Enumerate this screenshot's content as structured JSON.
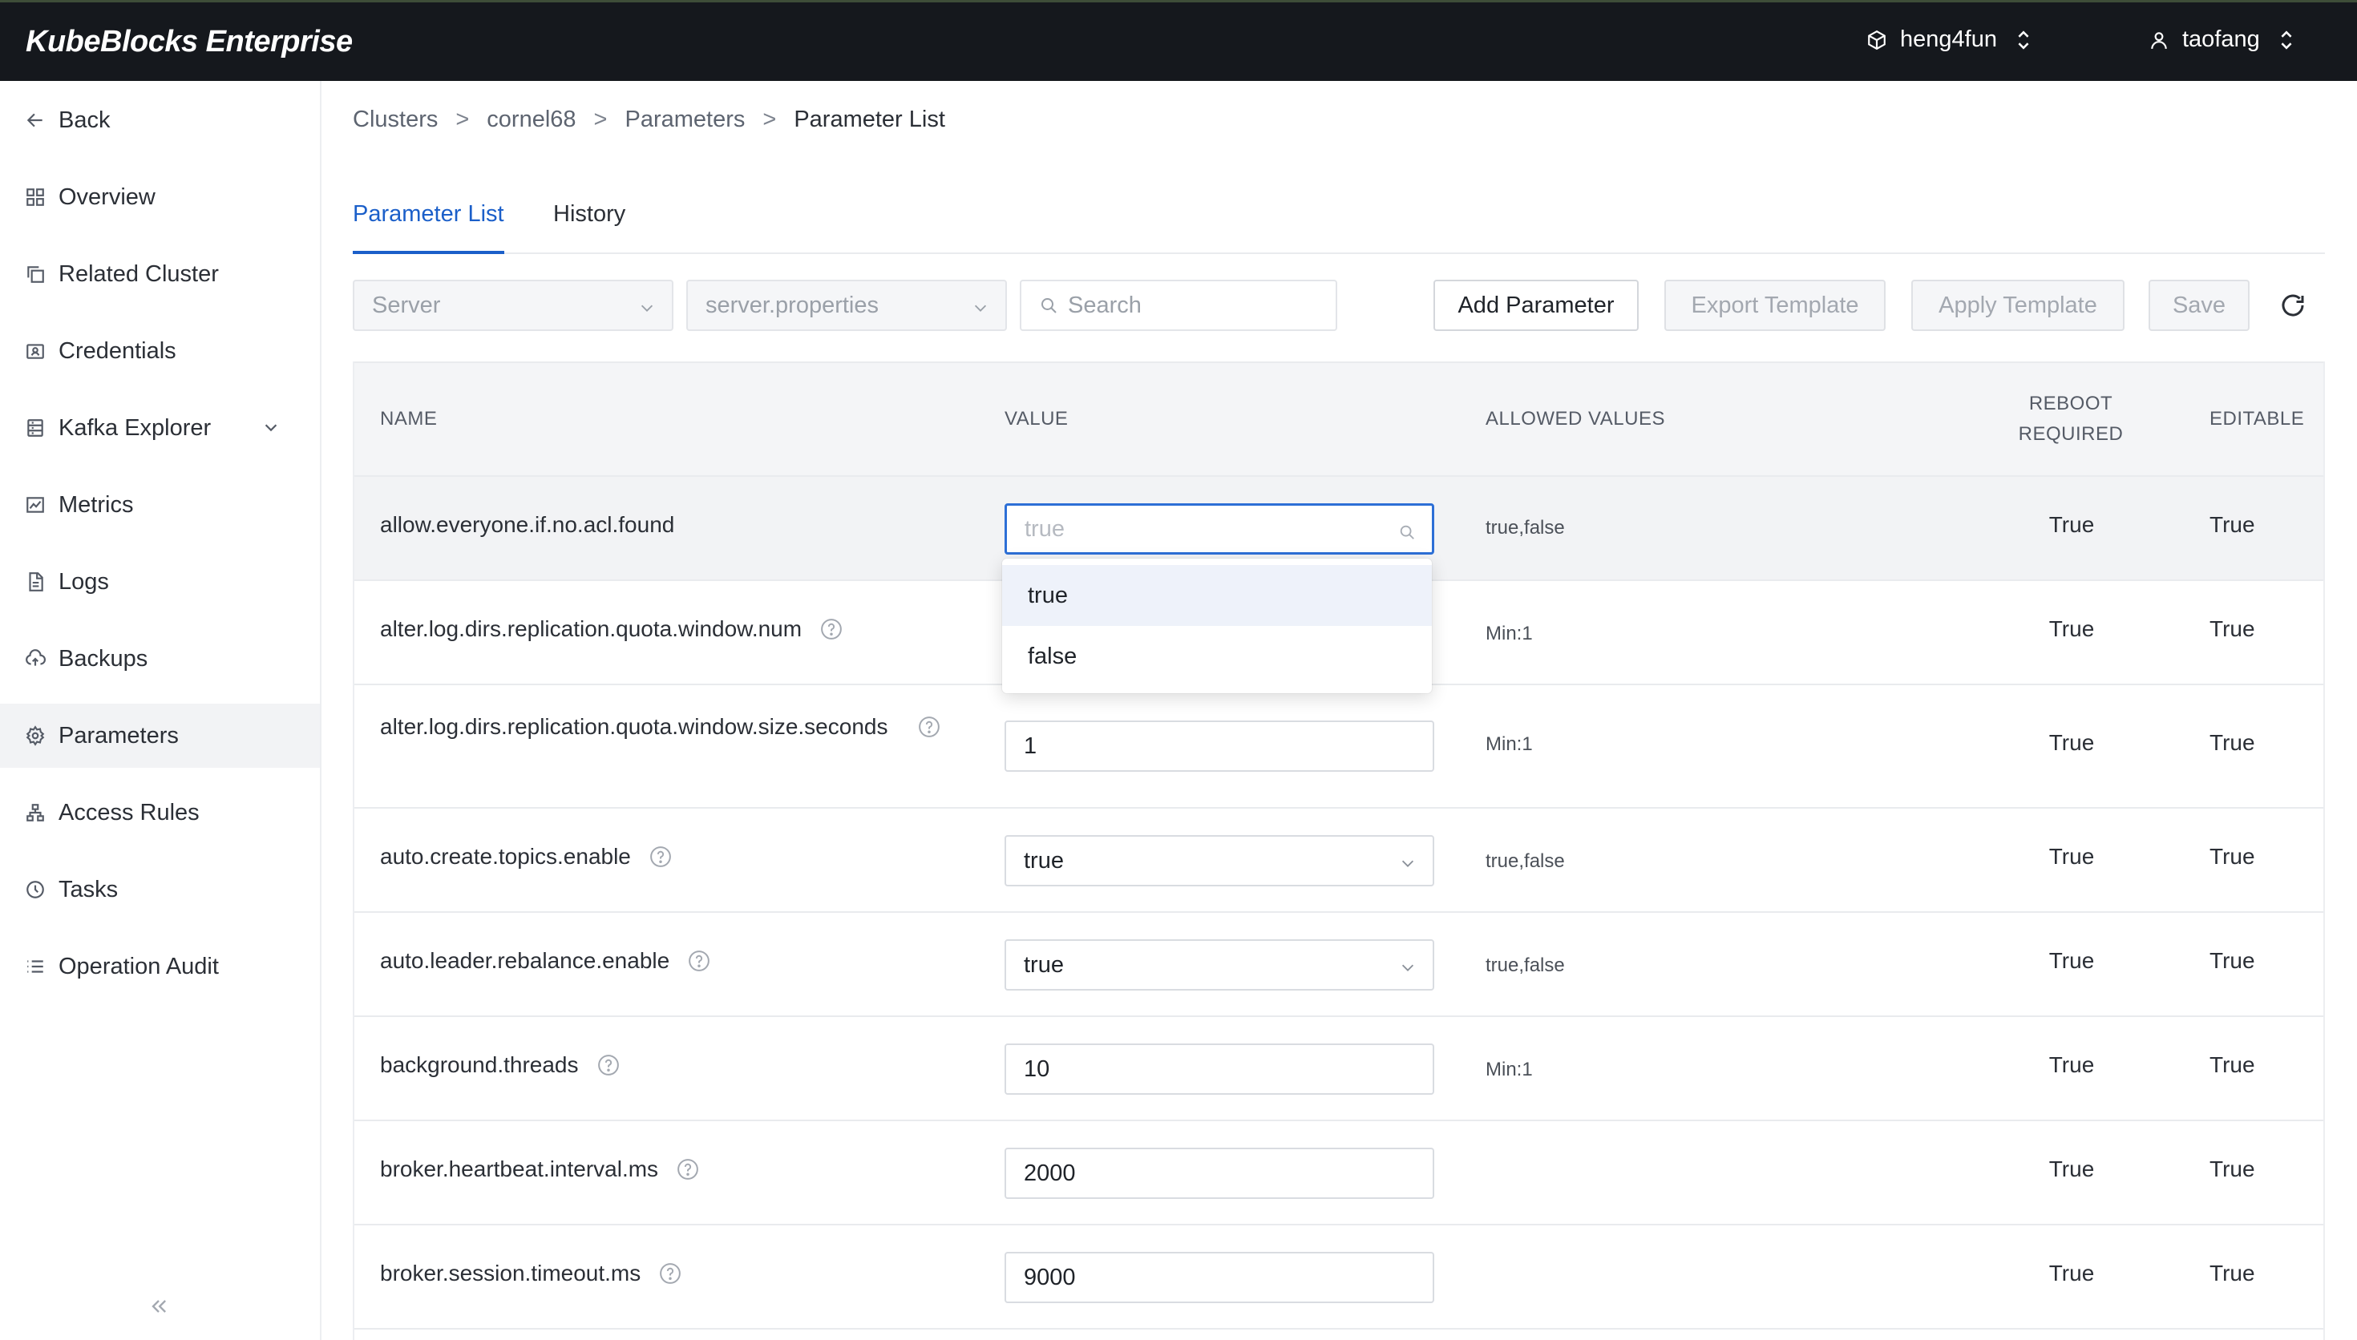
{
  "app": {
    "title": "KubeBlocks Enterprise"
  },
  "topbar": {
    "org": "heng4fun",
    "user": "taofang"
  },
  "sidebar": {
    "items": [
      {
        "label": "Back",
        "icon": "arrow-left-icon"
      },
      {
        "label": "Overview",
        "icon": "grid-icon"
      },
      {
        "label": "Related Cluster",
        "icon": "copy-icon"
      },
      {
        "label": "Credentials",
        "icon": "id-card-icon"
      },
      {
        "label": "Kafka Explorer",
        "icon": "database-icon"
      },
      {
        "label": "Metrics",
        "icon": "chart-icon"
      },
      {
        "label": "Logs",
        "icon": "file-icon"
      },
      {
        "label": "Backups",
        "icon": "cloud-upload-icon"
      },
      {
        "label": "Parameters",
        "icon": "gear-icon"
      },
      {
        "label": "Access Rules",
        "icon": "network-icon"
      },
      {
        "label": "Tasks",
        "icon": "clock-icon"
      },
      {
        "label": "Operation Audit",
        "icon": "list-icon"
      }
    ],
    "active": "Parameters"
  },
  "breadcrumb": [
    "Clusters",
    "cornel68",
    "Parameters",
    "Parameter List"
  ],
  "tabs": [
    {
      "label": "Parameter List",
      "active": true
    },
    {
      "label": "History",
      "active": false
    }
  ],
  "toolbar": {
    "component_select": "Server",
    "file_select": "server.properties",
    "search_placeholder": "Search",
    "add_label": "Add Parameter",
    "export_label": "Export Template",
    "apply_label": "Apply Template",
    "save_label": "Save"
  },
  "table": {
    "headers": {
      "name": "NAME",
      "value": "VALUE",
      "allowed": "ALLOWED VALUES",
      "reboot_1": "REBOOT",
      "reboot_2": "REQUIRED",
      "editable": "EDITABLE"
    },
    "rows": [
      {
        "name": "allow.everyone.if.no.acl.found",
        "value": "true",
        "allowed": "true,false",
        "reboot": "True",
        "editable": "True"
      },
      {
        "name": "alter.log.dirs.replication.quota.window.num",
        "value": "",
        "allowed": "Min:1",
        "reboot": "True",
        "editable": "True"
      },
      {
        "name": "alter.log.dirs.replication.quota.window.size.seconds",
        "value": "1",
        "allowed": "Min:1",
        "reboot": "True",
        "editable": "True"
      },
      {
        "name": "auto.create.topics.enable",
        "value": "true",
        "allowed": "true,false",
        "reboot": "True",
        "editable": "True"
      },
      {
        "name": "auto.leader.rebalance.enable",
        "value": "true",
        "allowed": "true,false",
        "reboot": "True",
        "editable": "True"
      },
      {
        "name": "background.threads",
        "value": "10",
        "allowed": "Min:1",
        "reboot": "True",
        "editable": "True"
      },
      {
        "name": "broker.heartbeat.interval.ms",
        "value": "2000",
        "allowed": "",
        "reboot": "True",
        "editable": "True"
      },
      {
        "name": "broker.session.timeout.ms",
        "value": "9000",
        "allowed": "",
        "reboot": "True",
        "editable": "True"
      }
    ]
  },
  "dropdown": {
    "options": [
      "true",
      "false"
    ]
  },
  "colors": {
    "accent": "#1b5fc9",
    "topbar": "#15181d",
    "header_bg": "#f4f5f7"
  }
}
